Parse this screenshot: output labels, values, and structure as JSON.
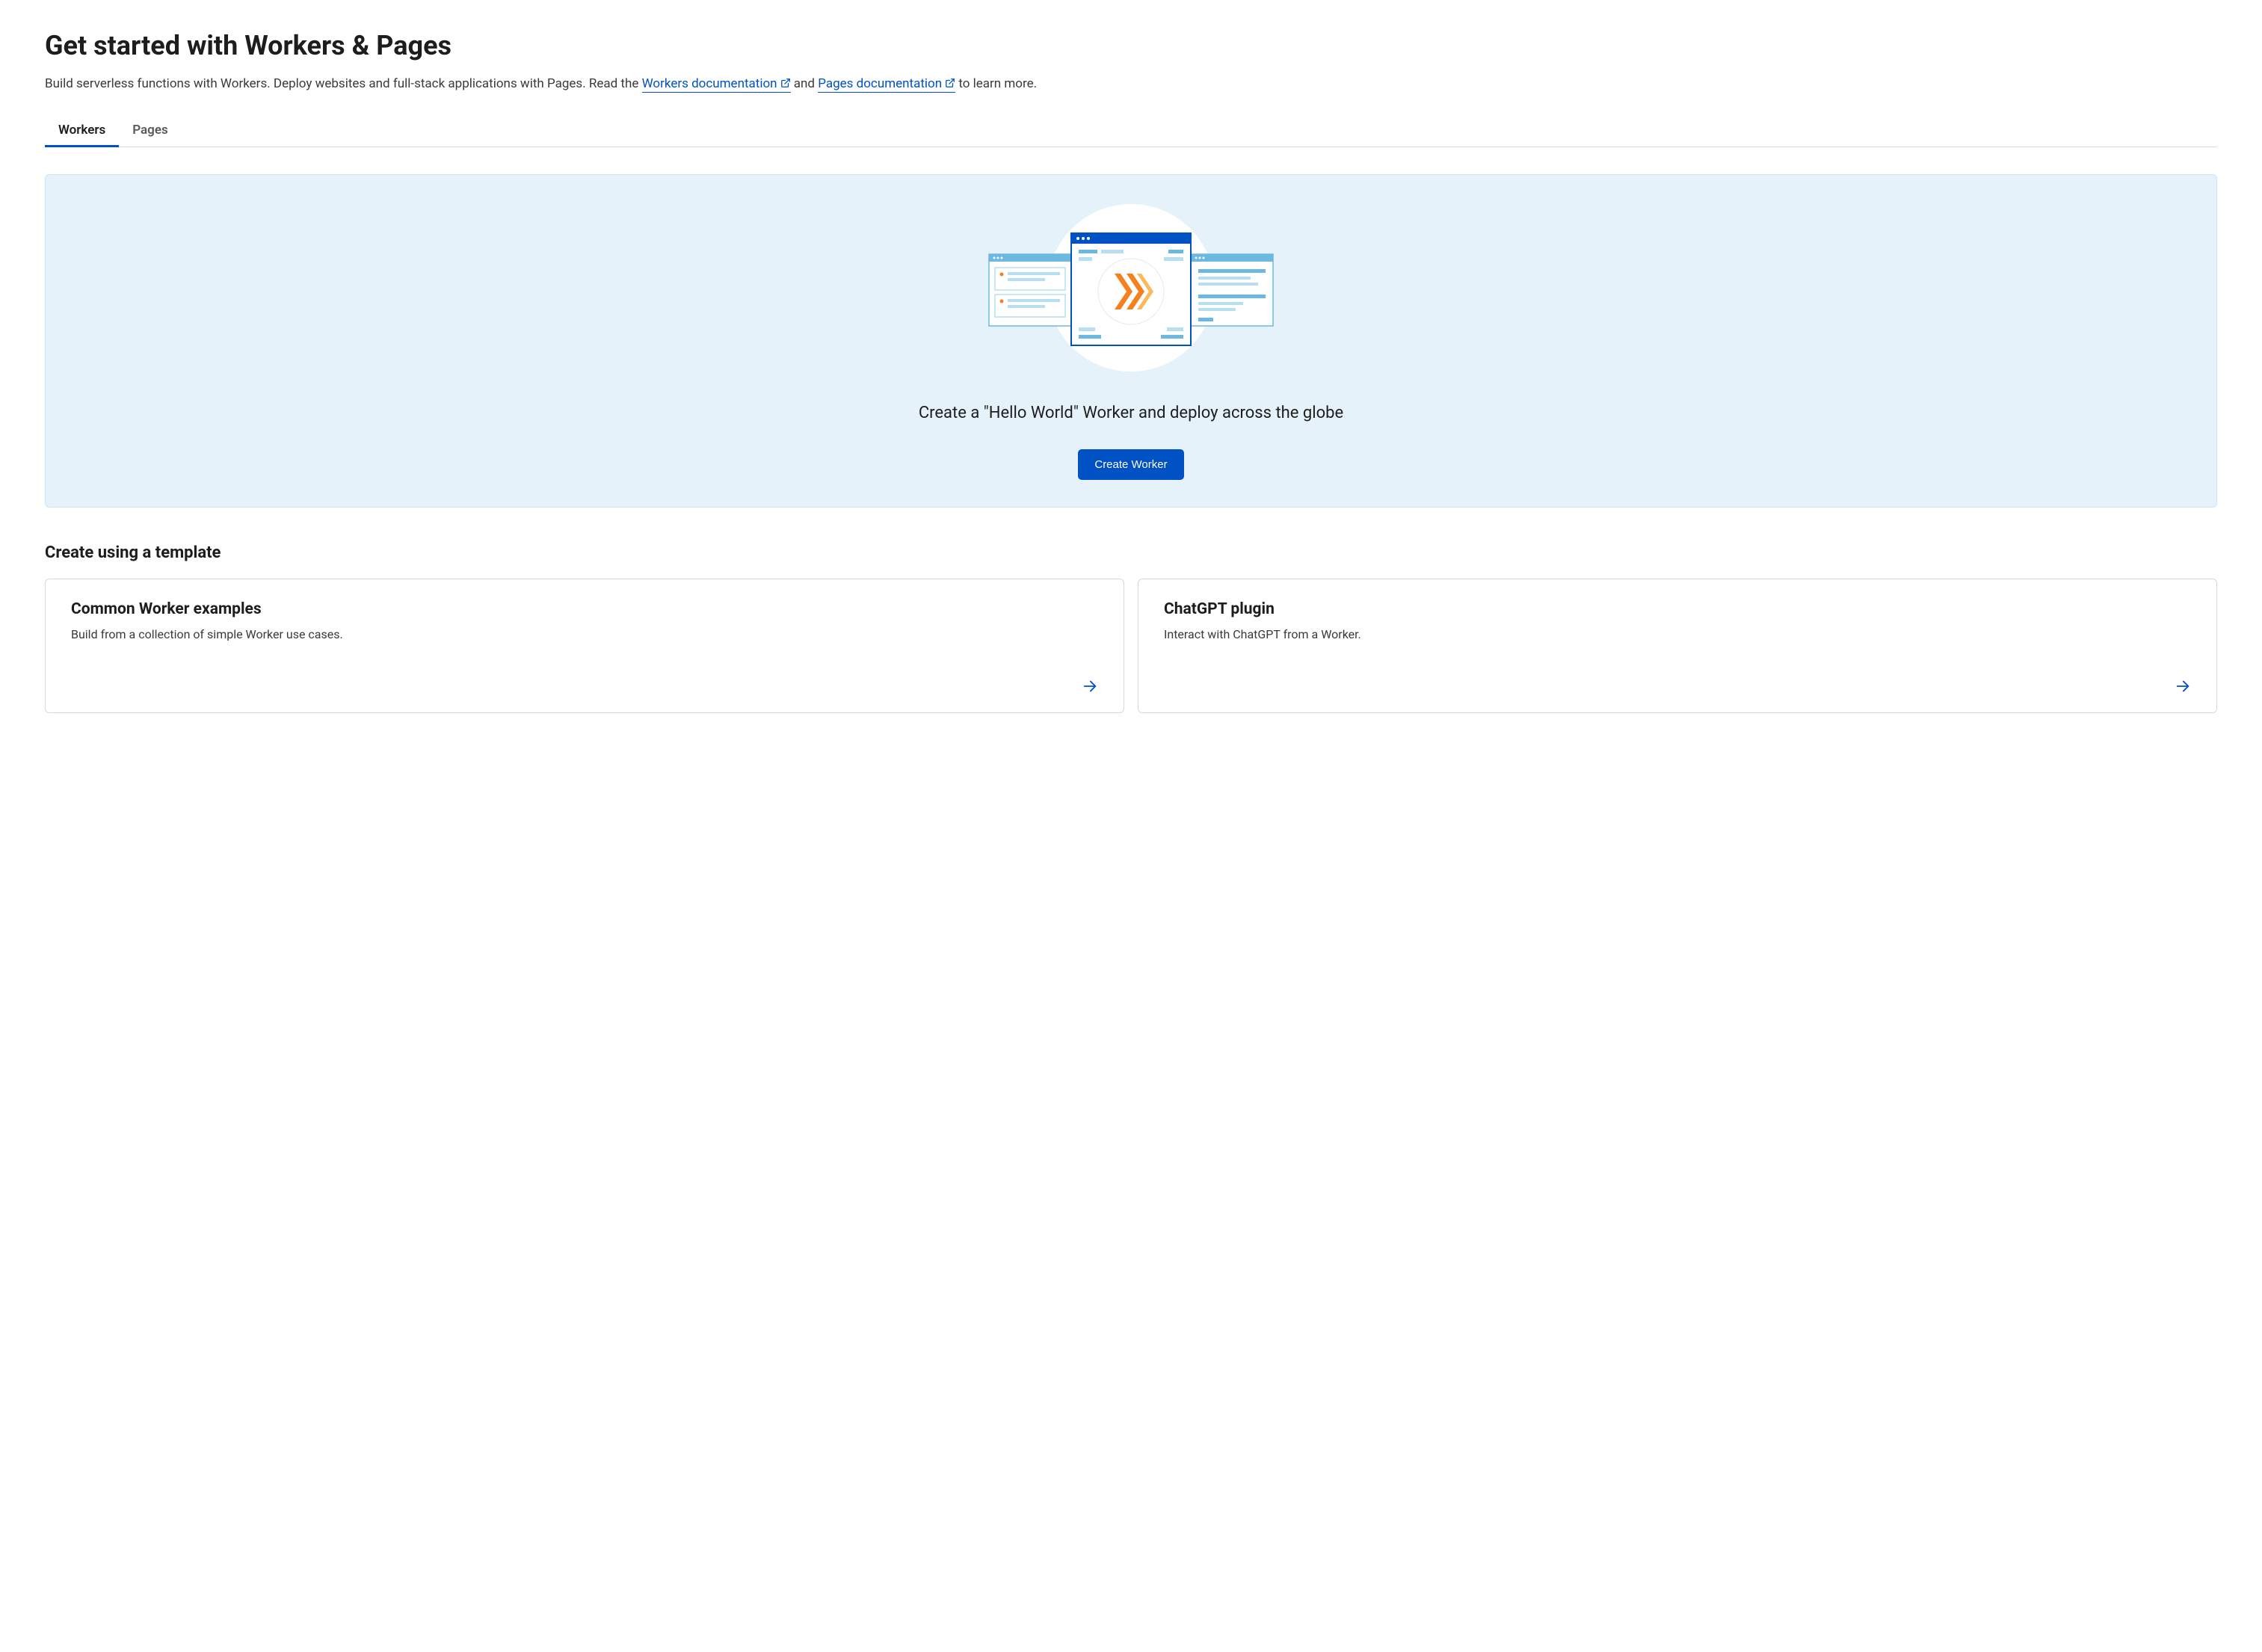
{
  "header": {
    "title": "Get started with Workers & Pages",
    "description_prefix": "Build serverless functions with Workers. Deploy websites and full-stack applications with Pages. Read the ",
    "workers_doc_link": "Workers documentation",
    "description_mid": " and ",
    "pages_doc_link": "Pages documentation",
    "description_suffix": " to learn more."
  },
  "tabs": {
    "workers": "Workers",
    "pages": "Pages"
  },
  "hero": {
    "tagline": "Create a \"Hello World\" Worker and deploy across the globe",
    "button": "Create Worker"
  },
  "templates": {
    "heading": "Create using a template",
    "cards": [
      {
        "title": "Common Worker examples",
        "desc": "Build from a collection of simple Worker use cases."
      },
      {
        "title": "ChatGPT plugin",
        "desc": "Interact with ChatGPT from a Worker."
      }
    ]
  }
}
